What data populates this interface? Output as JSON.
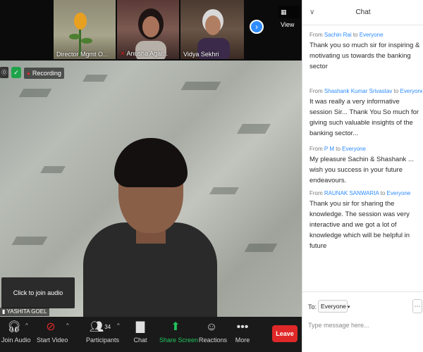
{
  "top_bar": {
    "view_label": "View",
    "next_icon": "chevron-right-icon"
  },
  "participants_strip": [
    {
      "name": "Director Mgmt O...",
      "muted": false
    },
    {
      "name": "Anusha Agar...",
      "muted": true
    },
    {
      "name": "Vidya Sekhri",
      "muted": false
    }
  ],
  "meeting_status": {
    "security_icon": "info-icon",
    "shield_icon": "shield-check-icon",
    "recording_label": "Recording",
    "join_audio_popup": "Click to join audio",
    "active_speaker": "YASHITA GOEL"
  },
  "toolbar": {
    "join_audio": "Join Audio",
    "start_video": "Start Video",
    "participants": "Participants",
    "participants_count": "34",
    "chat": "Chat",
    "share_screen": "Share Screen",
    "reactions": "Reactions",
    "more": "More",
    "leave": "Leave"
  },
  "chat": {
    "title": "Chat",
    "from_label": "From",
    "to_word": "to",
    "messages": [
      {
        "sender": "Sachin Rai",
        "recipient": "Everyone",
        "text": "Thank you so much sir for inspiring & motivating us towards the banking sector"
      },
      {
        "sender": "Shashank Kumar Srivastav",
        "recipient": "Everyone",
        "text": "It was really a very informative session Sir... Thank You So much for giving such valuable insights of the banking sector..."
      },
      {
        "sender": "P M",
        "recipient": "Everyone",
        "text": "My pleasure Sachin & Shashank ... wish you success  in your future endeavours."
      },
      {
        "sender": "RAUNAK SANWARIA",
        "recipient": "Everyone",
        "text": "Thank you sir for sharing the knowledge. The session was very interactive and we got a lot of knowledge which will be helpful in future"
      }
    ],
    "to_label": "To:",
    "to_value": "Everyone",
    "input_placeholder": "Type message here..."
  },
  "colors": {
    "accent": "#2d8cff",
    "leave": "#e02828",
    "share": "#21c55d"
  }
}
